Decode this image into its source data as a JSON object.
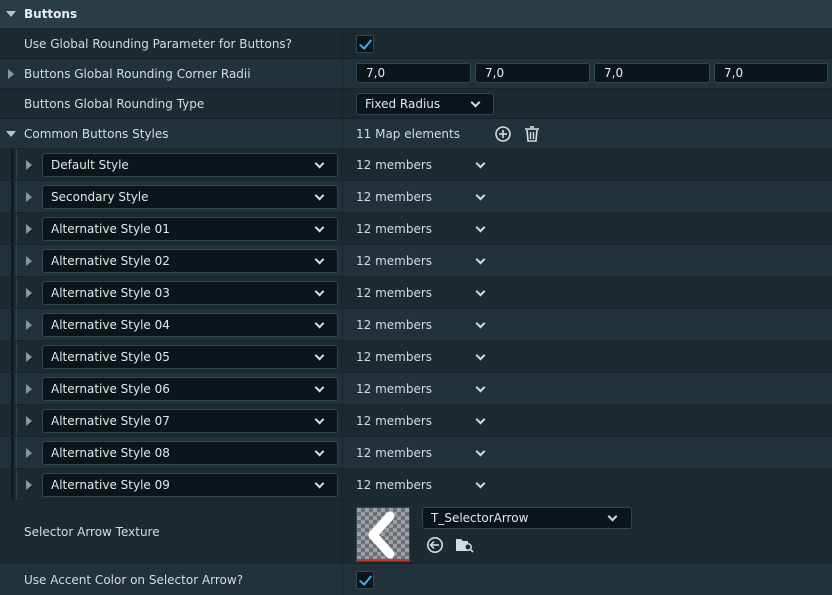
{
  "section": {
    "title": "Buttons"
  },
  "rows": {
    "use_global_rounding": {
      "label": "Use Global Rounding Parameter for Buttons?",
      "checked": true
    },
    "corner_radii": {
      "label": "Buttons Global Rounding Corner Radii",
      "values": [
        "7,0",
        "7,0",
        "7,0",
        "7,0"
      ]
    },
    "rounding_type": {
      "label": "Buttons Global Rounding Type",
      "selected": "Fixed Radius"
    },
    "common_styles": {
      "label": "Common Buttons Styles",
      "summary": "11 Map elements"
    },
    "selector_arrow": {
      "label": "Selector Arrow Texture",
      "asset": "T_SelectorArrow"
    },
    "use_accent_color": {
      "label": "Use Accent Color on Selector Arrow?",
      "checked": true
    }
  },
  "styles": [
    {
      "key": "Default Style",
      "members": "12 members"
    },
    {
      "key": "Secondary Style",
      "members": "12 members"
    },
    {
      "key": "Alternative Style 01",
      "members": "12 members"
    },
    {
      "key": "Alternative Style 02",
      "members": "12 members"
    },
    {
      "key": "Alternative Style 03",
      "members": "12 members"
    },
    {
      "key": "Alternative Style 04",
      "members": "12 members"
    },
    {
      "key": "Alternative Style 05",
      "members": "12 members"
    },
    {
      "key": "Alternative Style 06",
      "members": "12 members"
    },
    {
      "key": "Alternative Style 07",
      "members": "12 members"
    },
    {
      "key": "Alternative Style 08",
      "members": "12 members"
    },
    {
      "key": "Alternative Style 09",
      "members": "12 members"
    }
  ],
  "colors": {
    "accent": "#4aa8e0",
    "panel": "#1e2a2f",
    "header": "#2a3d44"
  },
  "icons": {
    "add": "plus-circle-icon",
    "delete": "trash-icon",
    "use_selected": "arrow-left-circle-icon",
    "browse": "folder-search-icon"
  }
}
